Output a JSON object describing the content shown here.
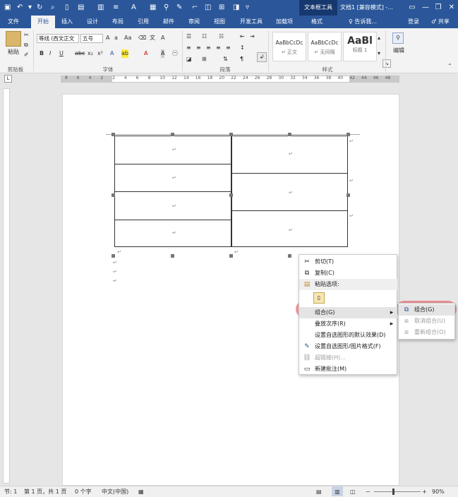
{
  "titlebar": {
    "context_tool": "文本框工具",
    "title": "文档1 [兼容模式] -...",
    "minimize": "—",
    "restore": "❐",
    "close": "✕"
  },
  "tabs": [
    {
      "label": "文件"
    },
    {
      "label": "开始"
    },
    {
      "label": "插入"
    },
    {
      "label": "设计"
    },
    {
      "label": "布局"
    },
    {
      "label": "引用"
    },
    {
      "label": "邮件"
    },
    {
      "label": "审阅"
    },
    {
      "label": "视图"
    },
    {
      "label": "开发工具"
    },
    {
      "label": "加载项"
    },
    {
      "label": "格式"
    }
  ],
  "tellme": "♀ 告诉我...",
  "account": {
    "login": "登录",
    "share": "♂ 共享"
  },
  "ribbon": {
    "paste_label": "粘贴",
    "font_name": "等线 (西文正文",
    "font_size": "五号",
    "styles": [
      {
        "sample": "AaBbCcDc",
        "name": "↵ 正文"
      },
      {
        "sample": "AaBbCcDc",
        "name": "↵ 无间隔"
      },
      {
        "sample": "AaBl",
        "name": "标题 1"
      }
    ],
    "edit_label": "编辑",
    "groups": {
      "clipboard": "剪贴板",
      "font": "字体",
      "paragraph": "段落",
      "styles": "样式"
    }
  },
  "ruler_marks": [
    "8",
    "6",
    "4",
    "2",
    "2",
    "4",
    "6",
    "8",
    "10",
    "12",
    "14",
    "16",
    "18",
    "20",
    "22",
    "24",
    "26",
    "28",
    "30",
    "32",
    "34",
    "36",
    "38",
    "40",
    "42",
    "44",
    "46",
    "48"
  ],
  "context_menu": {
    "items": [
      {
        "label": "剪切(T)",
        "icon": "scissors-icon"
      },
      {
        "label": "复制(C)",
        "icon": "copy-icon"
      },
      {
        "label": "粘贴选项:",
        "icon": "paste-icon"
      },
      {
        "label": "组合(G)",
        "icon": ""
      },
      {
        "label": "叠放次序(R)",
        "icon": ""
      },
      {
        "label": "设置自选图形的默认效果(D)",
        "icon": ""
      },
      {
        "label": "设置自选图形/图片格式(F)",
        "icon": "format-shape-icon"
      },
      {
        "label": "超链接(H)...",
        "icon": "hyperlink-icon"
      },
      {
        "label": "新建批注(M)",
        "icon": "comment-icon"
      }
    ]
  },
  "submenu": {
    "items": [
      {
        "label": "组合(G)"
      },
      {
        "label": "取消组合(U)"
      },
      {
        "label": "重新组合(O)"
      }
    ]
  },
  "statusbar": {
    "section": "节: 1",
    "page": "第 1 页，共 1 页",
    "words": "0 个字",
    "language": "中文(中国)",
    "zoom": "90%"
  }
}
